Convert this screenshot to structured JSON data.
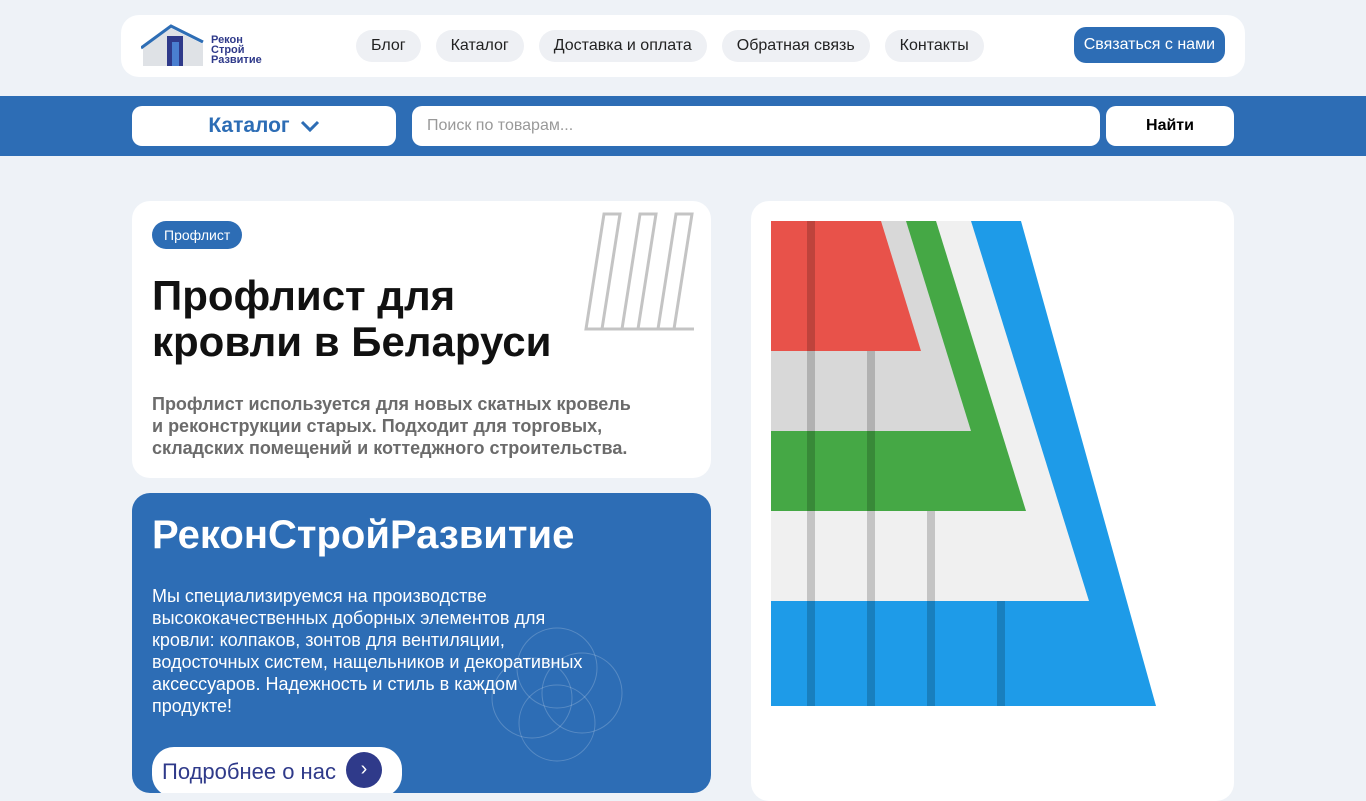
{
  "header": {
    "logo_text": [
      "Рекон",
      "Строй",
      "Развитие"
    ],
    "nav": [
      "Блог",
      "Каталог",
      "Доставка и оплата",
      "Обратная связь",
      "Контакты"
    ],
    "contact_button": "Связаться с нами"
  },
  "searchbar": {
    "catalog_label": "Каталог",
    "search_placeholder": "Поиск по товарам...",
    "find_button": "Найти"
  },
  "hero": {
    "badge": "Профлист",
    "title": "Профлист для кровли в Беларуси",
    "description": "Профлист используется для новых скатных кровель и реконструкции старых. Подходит для торговых, складских помещений и коттеджного строительства."
  },
  "about": {
    "title": "РеконСтройРазвитие",
    "text": "Мы специализируемся на производстве высококачественных доборных элементов для кровли: колпаков, зонтов для вентиляции, водосточных систем, нащельников и декоративных аксессуаров. Надежность и стиль в каждом продукте!",
    "more_button": "Подробнее о нас"
  },
  "colors": {
    "primary": "#2d6db5",
    "navy": "#2f3a8a",
    "background": "#eef2f7"
  }
}
